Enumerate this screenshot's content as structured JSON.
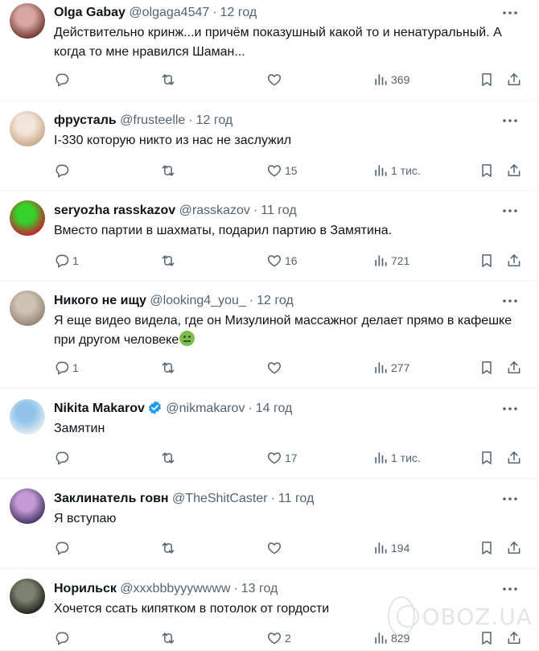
{
  "tweets": [
    {
      "name": "Olga Gabay",
      "handle": "@olgaga4547",
      "time": "12 год",
      "verified": false,
      "text": "Действительно кринж...и причём показушный какой то и ненатуральный. А когда то мне нравился Шаман...",
      "replies": "",
      "retweets": "",
      "likes": "",
      "views": "369",
      "avatar_colors": [
        "#d8a8a0",
        "#6a2f2a"
      ]
    },
    {
      "name": "фрусталь",
      "handle": "@frusteelle",
      "time": "12 год",
      "verified": false,
      "text": "I-330 которую никто из нас не заслужил",
      "replies": "",
      "retweets": "",
      "likes": "15",
      "views": "1 тис.",
      "avatar_colors": [
        "#f2e6dc",
        "#c9a483"
      ]
    },
    {
      "name": "seryozha rasskazov",
      "handle": "@rasskazov",
      "time": "11 год",
      "verified": false,
      "text": "Вместо партии в шахматы, подарил партию в Замятина.",
      "replies": "1",
      "retweets": "",
      "likes": "16",
      "views": "721",
      "avatar_colors": [
        "#36d12a",
        "#d0142c"
      ]
    },
    {
      "name": "Никого не ищу",
      "handle": "@looking4_you_",
      "time": "12 год",
      "verified": false,
      "text": "Я еще видео видела, где он Мизулиной массажног делает прямо в кафешке при другом человеке",
      "has_emoji": true,
      "emoji_name": "nauseated-face-emoji",
      "replies": "1",
      "retweets": "",
      "likes": "",
      "views": "277",
      "avatar_colors": [
        "#cfc3b4",
        "#8f8173"
      ]
    },
    {
      "name": "Nikita Makarov",
      "handle": "@nikmakarov",
      "time": "14 год",
      "verified": true,
      "text": "Замятин",
      "replies": "",
      "retweets": "",
      "likes": "17",
      "views": "1 тис.",
      "avatar_colors": [
        "#8fc3ea",
        "#e8eef3"
      ]
    },
    {
      "name": "Заклинатель говн",
      "handle": "@TheShitCaster",
      "time": "11 год",
      "verified": false,
      "text": "Я вступаю",
      "replies": "",
      "retweets": "",
      "likes": "",
      "views": "194",
      "avatar_colors": [
        "#c49bd6",
        "#3a2e5c"
      ]
    },
    {
      "name": "Норильск",
      "handle": "@xxxbbbyyywwww",
      "time": "13 год",
      "verified": false,
      "text": "Хочется ссать кипятком в потолок от гордости",
      "replies": "",
      "retweets": "",
      "likes": "2",
      "views": "829",
      "avatar_colors": [
        "#7c8270",
        "#1b1d16"
      ]
    }
  ],
  "icons": {
    "reply": "reply-icon",
    "retweet": "retweet-icon",
    "like": "heart-icon",
    "views": "views-chart-icon",
    "bookmark": "bookmark-icon",
    "share": "share-icon",
    "more": "more-dots-icon",
    "verified": "verified-badge-icon"
  },
  "colors": {
    "text": "#0f1419",
    "secondary": "#536471",
    "divider": "#eff3f4",
    "verified": "#1d9bf0"
  },
  "watermark": {
    "text": "OBOZ.UA"
  }
}
